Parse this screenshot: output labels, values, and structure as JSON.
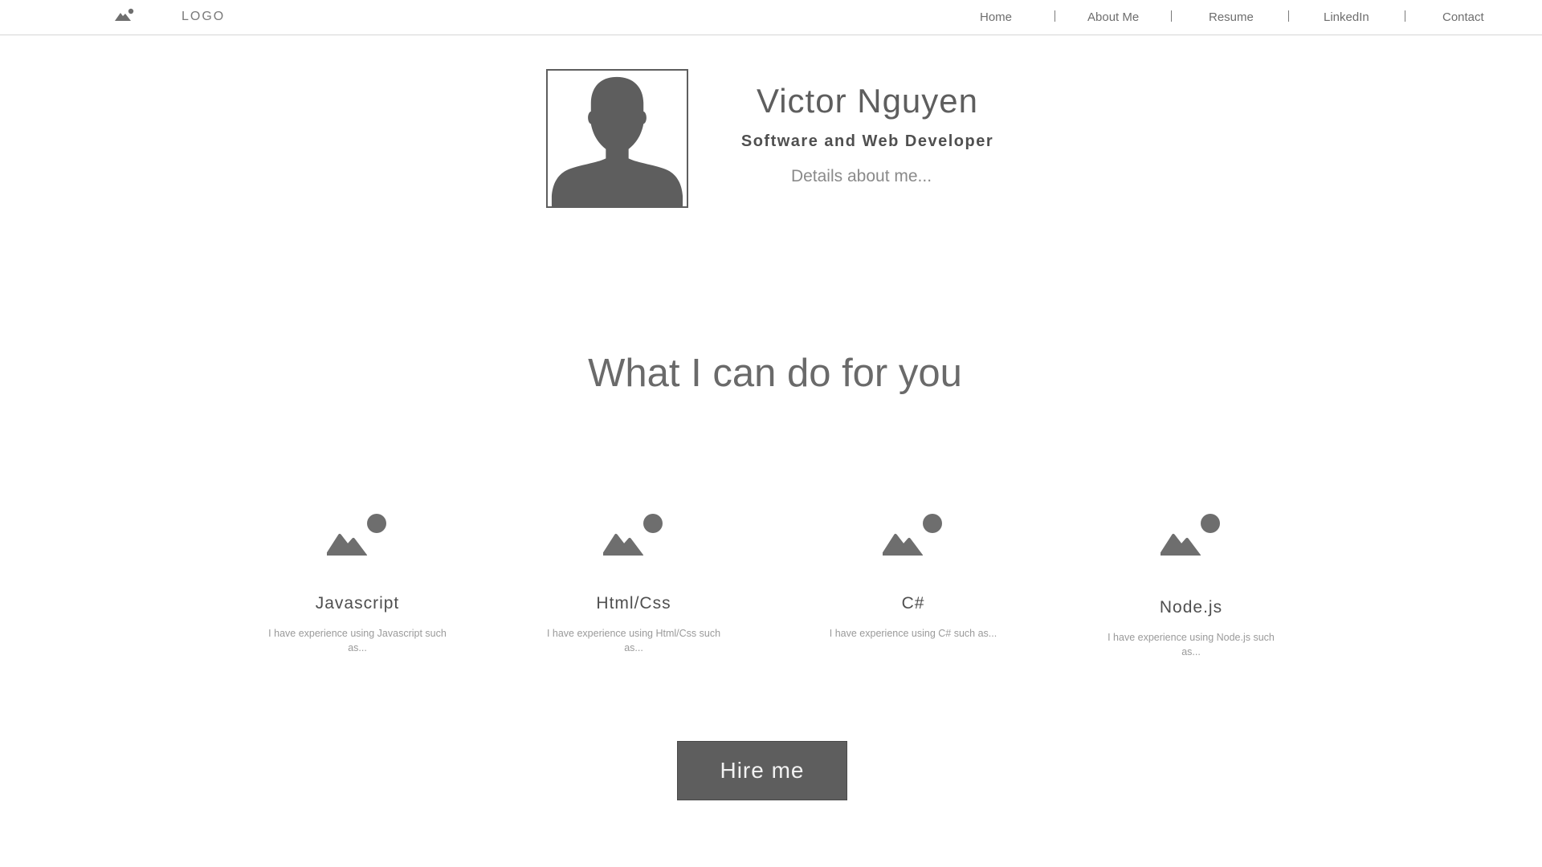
{
  "header": {
    "logo_icon": "image-placeholder-icon",
    "logo_text": "LOGO",
    "nav": [
      {
        "label": "Home"
      },
      {
        "label": "About Me"
      },
      {
        "label": "Resume"
      },
      {
        "label": "LinkedIn"
      },
      {
        "label": "Contact"
      }
    ]
  },
  "profile": {
    "avatar_icon": "person-silhouette-icon",
    "name": "Victor Nguyen",
    "role": "Software and Web Developer",
    "details": "Details about me..."
  },
  "services": {
    "heading": "What I can do for you",
    "items": [
      {
        "icon": "image-placeholder-icon",
        "title": "Javascript",
        "description": "I have experience using Javascript such as..."
      },
      {
        "icon": "image-placeholder-icon",
        "title": "Html/Css",
        "description": "I have experience using Html/Css such as..."
      },
      {
        "icon": "image-placeholder-icon",
        "title": "C#",
        "description": "I have experience using C# such as..."
      },
      {
        "icon": "image-placeholder-icon",
        "title": "Node.js",
        "description": "I have experience using Node.js such as..."
      }
    ]
  },
  "cta": {
    "hire_label": "Hire me"
  },
  "colors": {
    "primary_gray": "#5e5e5e",
    "text_light": "#9a9a9a",
    "border": "#d6d6d6",
    "background": "#ffffff"
  }
}
